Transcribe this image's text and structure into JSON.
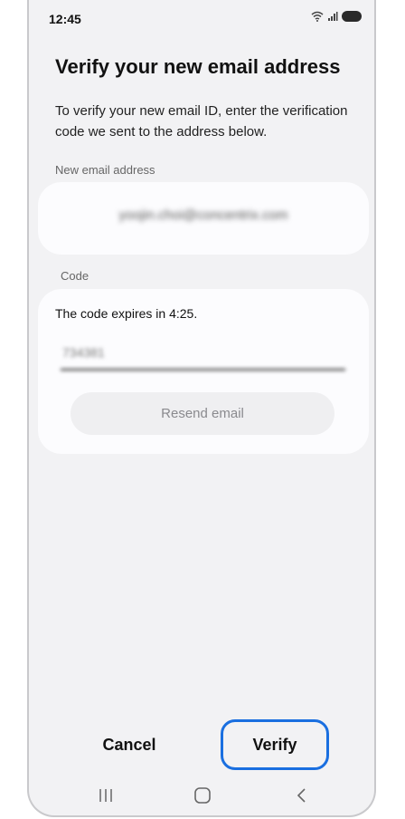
{
  "status_bar": {
    "time": "12:45"
  },
  "page": {
    "title": "Verify your new email address",
    "description": "To verify your new email ID, enter the verification code we sent to the address below."
  },
  "email_section": {
    "label": "New email address",
    "value": "yoojin.choi@concentrix.com"
  },
  "code_section": {
    "label": "Code",
    "expiry_text": "The code expires in 4:25.",
    "code_value": "734381",
    "resend_label": "Resend email"
  },
  "actions": {
    "cancel_label": "Cancel",
    "verify_label": "Verify"
  },
  "nav_bar": {
    "icons": [
      "recent-apps-icon",
      "home-icon",
      "back-icon"
    ]
  },
  "colors": {
    "accent": "#1a6fe0",
    "background": "#f2f2f4",
    "card": "#fcfcfe"
  }
}
